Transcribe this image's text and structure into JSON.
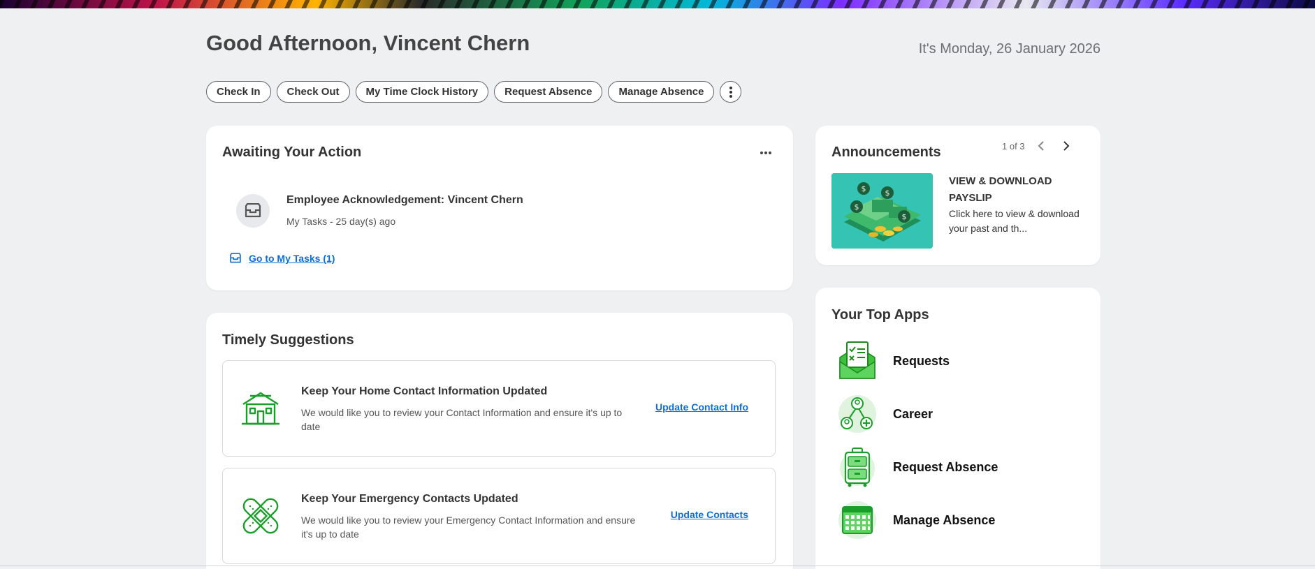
{
  "header": {
    "greeting": "Good Afternoon, Vincent Chern",
    "date": "It's Monday, 26 January 2026"
  },
  "quick_actions": [
    {
      "label": "Check In"
    },
    {
      "label": "Check Out"
    },
    {
      "label": "My Time Clock History"
    },
    {
      "label": "Request Absence"
    },
    {
      "label": "Manage Absence"
    }
  ],
  "awaiting": {
    "title": "Awaiting Your Action",
    "task_title": "Employee Acknowledgement: Vincent Chern",
    "task_subtitle": "My Tasks - 25 day(s) ago",
    "goto_link": "Go to My Tasks (1)"
  },
  "announcements": {
    "title": "Announcements",
    "pager": "1 of 3",
    "item_title": "VIEW & DOWNLOAD PAYSLIP",
    "item_description": "Click here to view & download your past and th..."
  },
  "timely": {
    "title": "Timely Suggestions",
    "items": [
      {
        "icon": "house-icon",
        "title": "Keep Your Home Contact Information Updated",
        "description": "We would like you to review your Contact Information and ensure it's up to date",
        "link": "Update Contact Info"
      },
      {
        "icon": "bandage-icon",
        "title": "Keep Your Emergency Contacts Updated",
        "description": "We would like you to review your Emergency Contact Information and ensure it's up to date",
        "link": "Update Contacts"
      }
    ]
  },
  "top_apps": {
    "title": "Your Top Apps",
    "items": [
      {
        "label": "Requests",
        "icon": "envelope-document-icon"
      },
      {
        "label": "Career",
        "icon": "career-network-icon"
      },
      {
        "label": "Request Absence",
        "icon": "suitcase-icon"
      },
      {
        "label": "Manage Absence",
        "icon": "calendar-icon"
      }
    ]
  },
  "colors": {
    "background": "#eff0f2",
    "link": "#0b6fd8",
    "icon_green": "#1a9e2a",
    "card": "#ffffff"
  }
}
